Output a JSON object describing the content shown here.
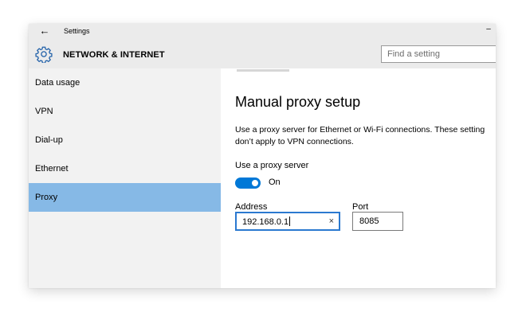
{
  "window": {
    "title": "Settings",
    "back_glyph": "←",
    "minimize_glyph": "–"
  },
  "header": {
    "icon": "gear-icon",
    "title": "NETWORK & INTERNET",
    "search_placeholder": "Find a setting"
  },
  "sidebar": {
    "items": [
      {
        "label": "Data usage",
        "active": false
      },
      {
        "label": "VPN",
        "active": false
      },
      {
        "label": "Dial-up",
        "active": false
      },
      {
        "label": "Ethernet",
        "active": false
      },
      {
        "label": "Proxy",
        "active": true
      }
    ]
  },
  "main": {
    "heading": "Manual proxy setup",
    "description_lines": [
      "Use a proxy server for Ethernet or Wi-Fi connections. These setting",
      "don’t apply to VPN connections."
    ],
    "use_proxy_label": "Use a proxy server",
    "toggle_state": "On",
    "address_label": "Address",
    "address_value": "192.168.0.1",
    "clear_glyph": "×",
    "port_label": "Port",
    "port_value": "8085"
  },
  "colors": {
    "accent": "#0078d7",
    "sidebar_active": "#86b9e6",
    "header_bg": "#ebebeb",
    "sidebar_bg": "#f2f2f2"
  }
}
